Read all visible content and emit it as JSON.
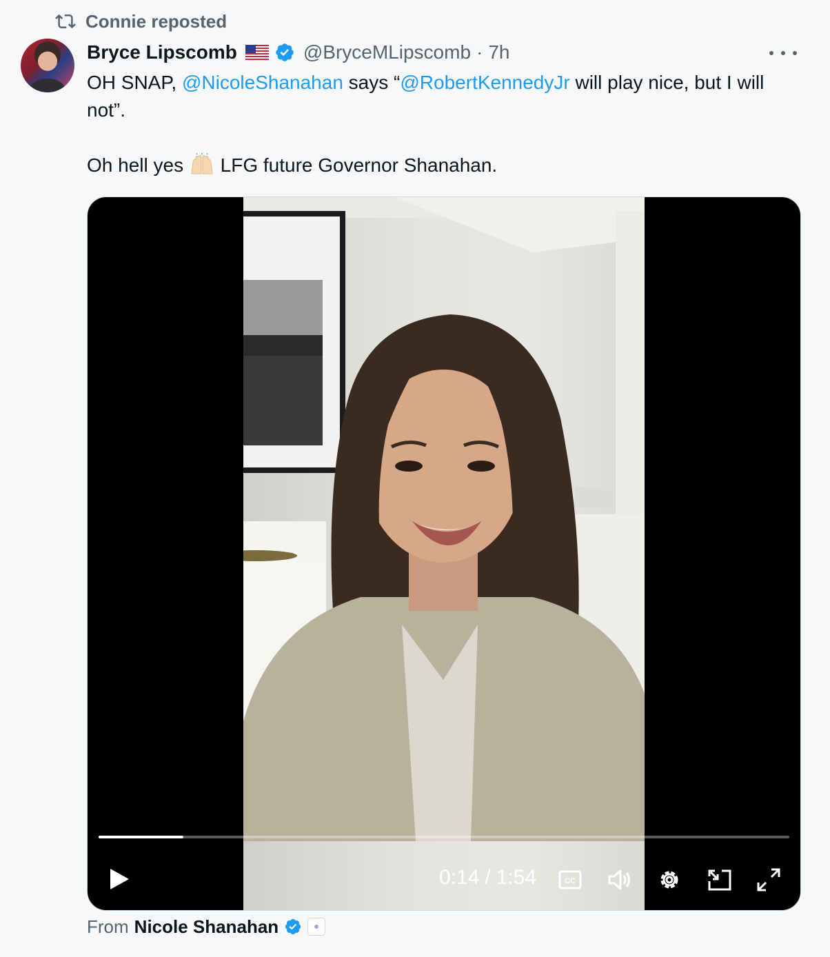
{
  "repost": {
    "label": "Connie reposted"
  },
  "post": {
    "display_name": "Bryce Lipscomb",
    "handle": "@BryceMLipscomb",
    "separator": "·",
    "time": "7h",
    "text": {
      "line1_a": "OH SNAP, ",
      "mention1": "@NicoleShanahan",
      "line1_b": " says “",
      "mention2": "@RobertKennedyJr",
      "line1_c": " will play nice, but I will not”.",
      "line2_a": "Oh hell yes ",
      "line2_b": " LFG future Governor Shanahan."
    }
  },
  "video": {
    "current_time": "0:14",
    "separator": "/",
    "duration": "1:54",
    "progress": 0.123
  },
  "attribution": {
    "prefix": "From",
    "name": "Nicole Shanahan"
  },
  "colors": {
    "accent": "#1d9bf0",
    "muted": "#536471",
    "text": "#0f1419"
  },
  "icons": [
    "repost-icon",
    "us-flag-icon",
    "verified-badge-icon",
    "more-icon",
    "raising-hands-emoji",
    "play-icon",
    "closed-captions-icon",
    "volume-icon",
    "settings-icon",
    "picture-in-picture-icon",
    "fullscreen-icon",
    "affiliate-badge-icon"
  ]
}
